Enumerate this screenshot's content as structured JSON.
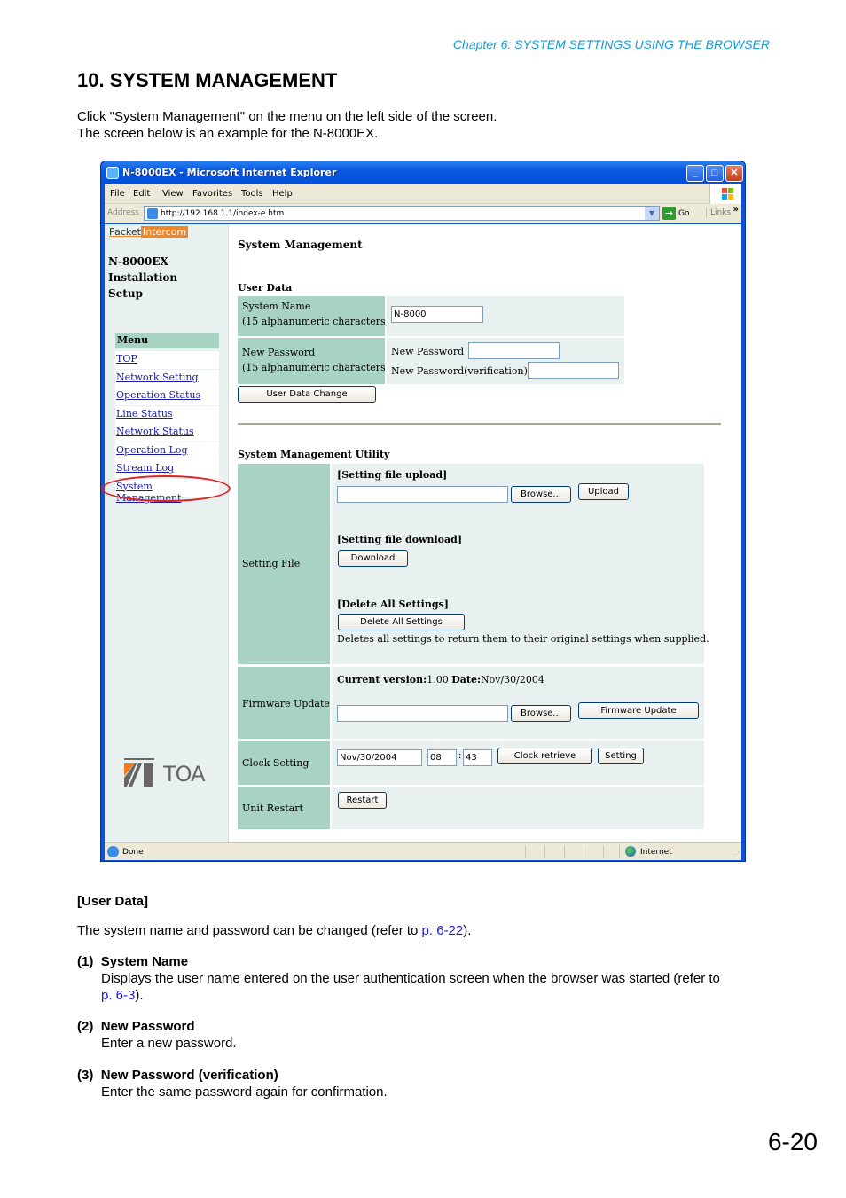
{
  "doc": {
    "chapter_header": "Chapter 6:  SYSTEM SETTINGS USING THE BROWSER",
    "section_title": "10. SYSTEM MANAGEMENT",
    "intro_lines": [
      "Click \"System Management\" on the menu on the left side of the screen.",
      "The screen below is an example for the N-8000EX."
    ],
    "user_data_heading": "[User Data]",
    "user_data_text_a": "The system name and password can be changed (refer to ",
    "user_data_link": "p. 6-22",
    "user_data_text_b": ").",
    "items": [
      {
        "num": "(1)",
        "title": "System Name",
        "text": "Displays the user name entered on the user authentication screen when the browser was started (refer to",
        "link": "p. 6-3",
        "tail": ")."
      },
      {
        "num": "(2)",
        "title": "New Password",
        "text": "Enter a new password."
      },
      {
        "num": "(3)",
        "title": "New Password (verification)",
        "text": "Enter the same password again for confirmation."
      }
    ],
    "page_number": "6-20"
  },
  "browser": {
    "title": "N-8000EX - Microsoft Internet Explorer",
    "menu": [
      "File",
      "Edit",
      "View",
      "Favorites",
      "Tools",
      "Help"
    ],
    "address_label": "Address",
    "url": "http://192.168.1.1/index-e.htm",
    "go_label": "Go",
    "links_label": "Links",
    "status_text": "Done",
    "zone_text": "Internet"
  },
  "sidebar": {
    "brand_a": "Packet",
    "brand_b": "Intercom",
    "product_lines": [
      "N-8000EX",
      "Installation",
      "Setup"
    ],
    "menu_heading": "Menu",
    "menu_items": [
      "TOP",
      "Network Setting",
      "Operation Status",
      "Line Status",
      "Network Status",
      "Operation Log",
      "Stream Log",
      "System Management"
    ],
    "selected": "System Management",
    "logo_text": "TOA"
  },
  "page": {
    "heading": "System Management",
    "user_data": {
      "heading": "User Data",
      "system_name_label": "System Name",
      "system_name_hint": "(15 alphanumeric characters)",
      "system_name_value": "N-8000",
      "password_label": "New Password",
      "password_hint": "(15 alphanumeric characters)",
      "new_password_label": "New Password",
      "new_password_value": "",
      "verify_label": "New Password(verification)",
      "verify_value": "",
      "change_button": "User Data Change"
    },
    "utility": {
      "heading": "System Management Utility",
      "setting_file_label": "Setting File",
      "upload_heading": "[Setting file upload]",
      "browse_button": "Browse...",
      "upload_button": "Upload",
      "download_heading": "[Setting file download]",
      "download_button": "Download",
      "delete_heading": "[Delete All Settings]",
      "delete_button": "Delete All Settings",
      "delete_note": "Deletes all settings to return them to their original settings when supplied.",
      "firmware_label": "Firmware Update",
      "current_version_label": "Current version:",
      "current_version": "1.00",
      "date_label": "Date:",
      "date": "Nov/30/2004",
      "firmware_button": "Firmware Update",
      "clock_label": "Clock Setting",
      "clock_date": "Nov/30/2004",
      "clock_hour": "08",
      "clock_sep": ":",
      "clock_minute": "43",
      "clock_retrieve_button": "Clock retrieve",
      "clock_setting_button": "Setting",
      "restart_label": "Unit Restart",
      "restart_button": "Restart"
    }
  }
}
